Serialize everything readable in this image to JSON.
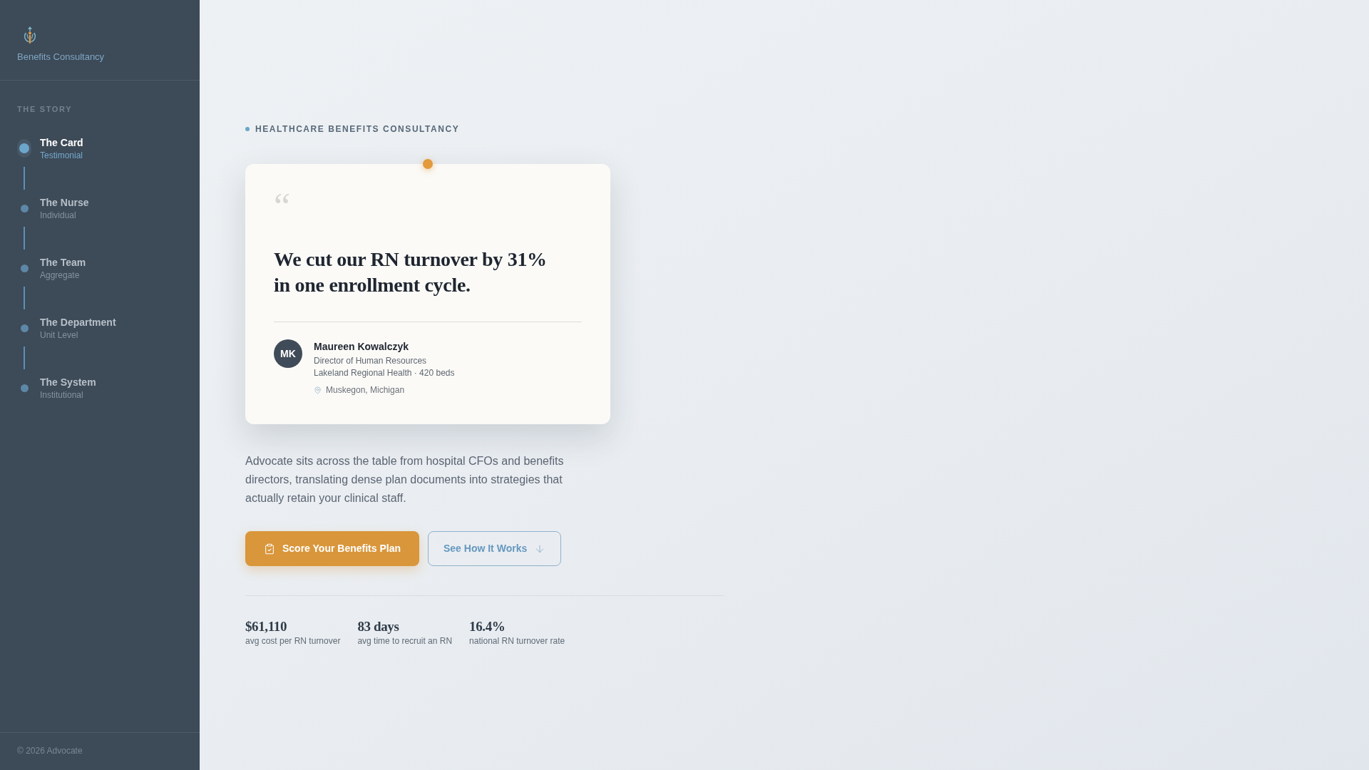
{
  "sidebar": {
    "brand": {
      "tagline": "Benefits Consultancy"
    },
    "section_title": "THE STORY",
    "items": [
      {
        "title": "The Card",
        "subtitle": "Testimonial",
        "selected": true
      },
      {
        "title": "The Nurse",
        "subtitle": "Individual",
        "selected": false
      },
      {
        "title": "The Team",
        "subtitle": "Aggregate",
        "selected": false
      },
      {
        "title": "The Department",
        "subtitle": "Unit Level",
        "selected": false
      },
      {
        "title": "The System",
        "subtitle": "Institutional",
        "selected": false
      }
    ],
    "footer": "© 2026 Advocate"
  },
  "hero": {
    "eyebrow": "HEALTHCARE BENEFITS CONSULTANCY",
    "card": {
      "quote_mark": "“",
      "quote": "We cut our RN turnover by 31% in one enrollment cycle.",
      "author": {
        "initials": "MK",
        "name": "Maureen Kowalczyk",
        "role": "Director of Human Resources",
        "organization": "Lakeland Regional Health · 420 beds",
        "location": "Muskegon, Michigan"
      }
    },
    "description": "Advocate sits across the table from hospital CFOs and benefits directors, translating dense plan documents into strategies that actually retain your clinical staff.",
    "buttons": [
      {
        "label": "Score Your Benefits Plan",
        "kind": "primary"
      },
      {
        "label": "See How It Works",
        "kind": "secondary"
      }
    ],
    "stats": [
      {
        "value": "$61,110",
        "label": "avg cost per RN turnover"
      },
      {
        "value": "83 days",
        "label": "avg time to recruit an RN"
      },
      {
        "value": "16.4%",
        "label": "national RN turnover rate"
      }
    ]
  }
}
